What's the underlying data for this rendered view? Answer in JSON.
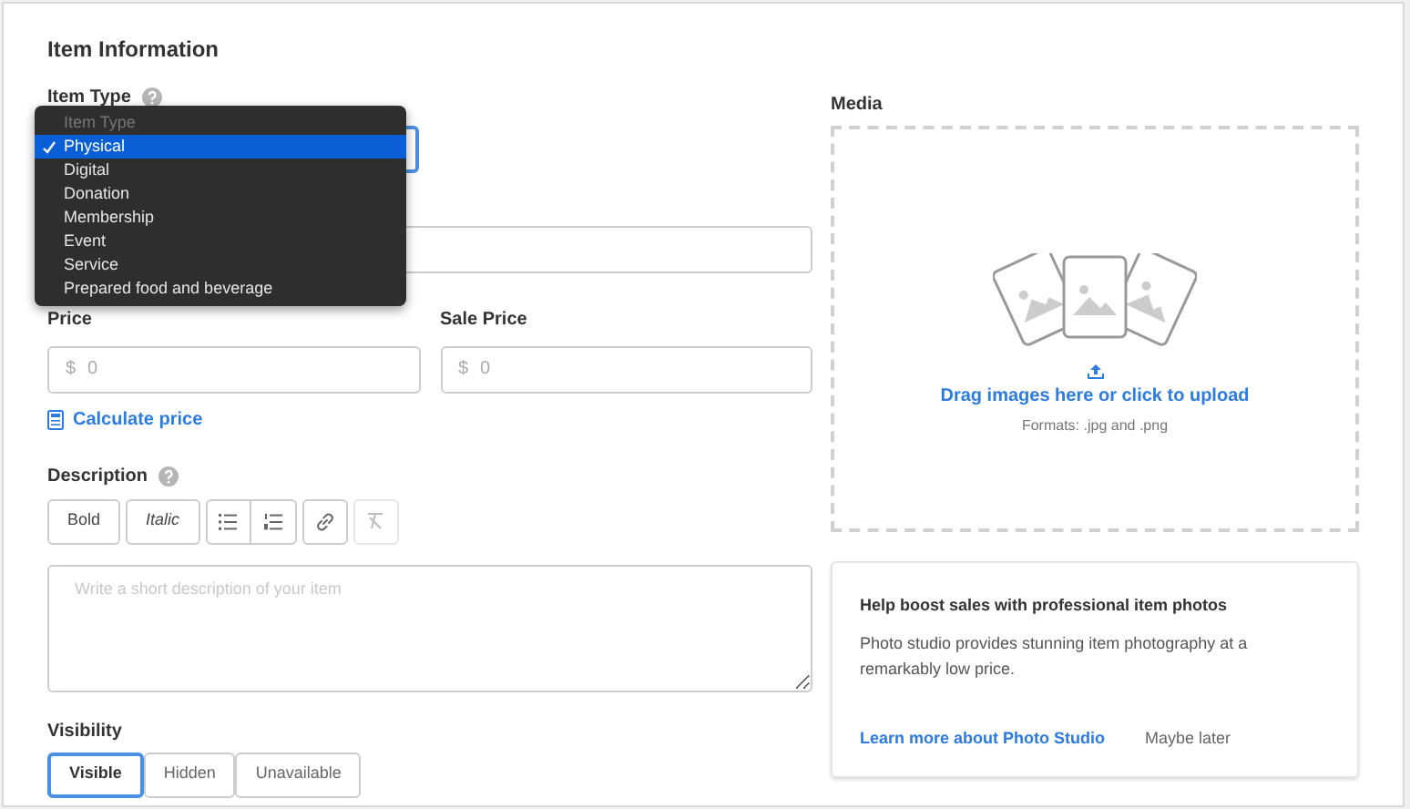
{
  "title": "Item Information",
  "item_type": {
    "label": "Item Type",
    "menu": {
      "header": "Item Type",
      "options": [
        {
          "label": "Physical",
          "selected": true
        },
        {
          "label": "Digital",
          "selected": false
        },
        {
          "label": "Donation",
          "selected": false
        },
        {
          "label": "Membership",
          "selected": false
        },
        {
          "label": "Event",
          "selected": false
        },
        {
          "label": "Service",
          "selected": false
        },
        {
          "label": "Prepared food and beverage",
          "selected": false
        }
      ]
    }
  },
  "price": {
    "label": "Price",
    "currency": "$",
    "placeholder": "0"
  },
  "sale_price": {
    "label": "Sale Price",
    "currency": "$",
    "placeholder": "0"
  },
  "calculate_price": "Calculate price",
  "description": {
    "label": "Description",
    "toolbar": [
      {
        "kind": "bold",
        "label": "Bold"
      },
      {
        "kind": "italic",
        "label": "Italic"
      }
    ],
    "placeholder": "Write a short description of your item"
  },
  "visibility": {
    "label": "Visibility",
    "options": [
      {
        "label": "Visible",
        "selected": true
      },
      {
        "label": "Hidden",
        "selected": false
      },
      {
        "label": "Unavailable",
        "selected": false
      }
    ]
  },
  "media": {
    "label": "Media",
    "upload_text": "Drag images here or click to upload",
    "formats": "Formats: .jpg and .png"
  },
  "promo": {
    "title": "Help boost sales with professional item photos",
    "body": "Photo studio provides stunning item photography at a remarkably low price.",
    "link": "Learn more about Photo Studio",
    "dismiss": "Maybe later"
  }
}
